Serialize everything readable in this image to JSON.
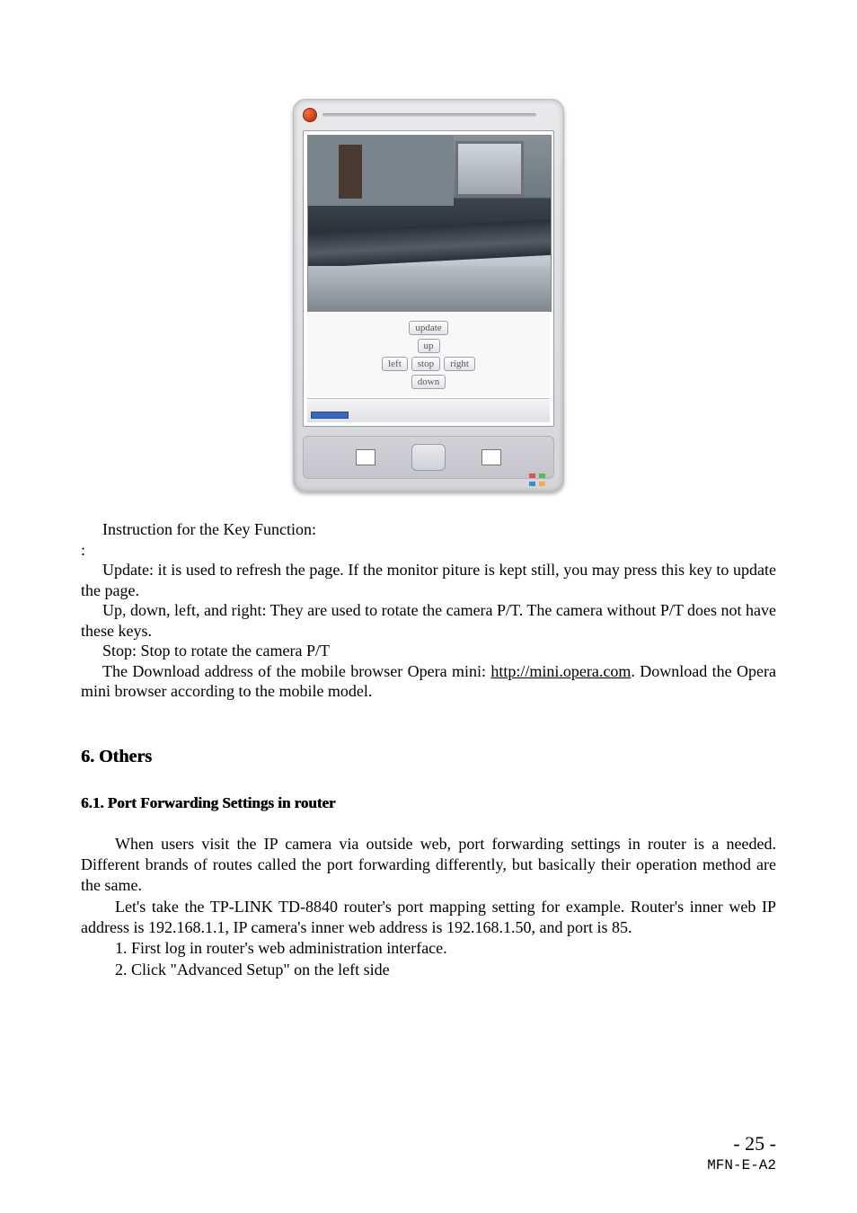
{
  "device": {
    "buttons": {
      "update": "update",
      "up": "up",
      "left": "left",
      "stop": "stop",
      "right": "right",
      "down": "down"
    }
  },
  "body": {
    "line1": "Instruction for the Key Function:",
    "colon": ":",
    "line2": "Update: it is used to refresh the page. If the monitor piture is kept still, you may press this key to update the page.",
    "line3": "Up, down, left, and right: They are used to rotate the camera P/T. The camera without P/T does not have these keys.",
    "line4": "Stop: Stop to rotate the camera P/T",
    "line5a": "The Download address of the mobile browser Opera mini: ",
    "link": "http://mini.opera.com",
    "line5b": ". Download the Opera mini browser according to the mobile model."
  },
  "section6": {
    "heading": "6. Others",
    "sub61": "6.1. Port Forwarding Settings in router",
    "p1": "When users visit the IP camera via outside web, port forwarding settings in router is a needed. Different brands of routes called the port forwarding differently, but basically their operation method are the same.",
    "p2": "Let's take the TP-LINK TD-8840 router's port mapping setting for example. Router's inner web IP address is 192.168.1.1, IP camera's inner web address is 192.168.1.50, and port is 85.",
    "li1": "1.  First log in router's web administration interface.",
    "li2": "2.  Click \"Advanced Setup\" on the left side"
  },
  "footer": {
    "page": "- 25 -",
    "code": "MFN-E-A2"
  }
}
